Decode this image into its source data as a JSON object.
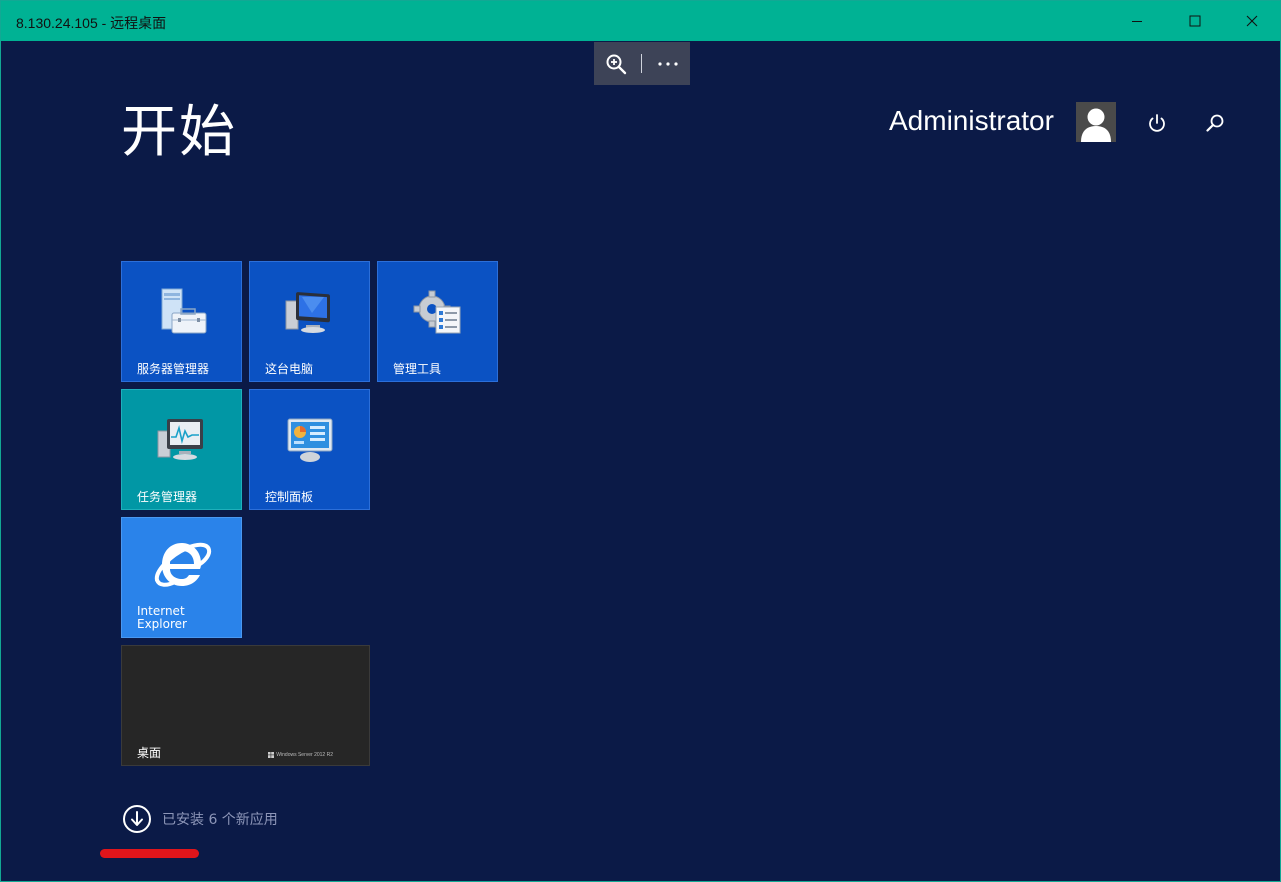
{
  "window": {
    "title": "8.130.24.105 - 远程桌面",
    "accent_color": "#00b294",
    "controls": [
      "minimize-icon",
      "maximize-icon",
      "close-icon"
    ]
  },
  "rdp_bar": {
    "icons": [
      "zoom-in-icon",
      "more-options-icon"
    ]
  },
  "start": {
    "title": "开始",
    "user": {
      "name": "Administrator",
      "avatar_icon": "user-avatar-icon"
    },
    "top_icons": [
      "power-icon",
      "search-icon"
    ],
    "background_color": "#0b1a47"
  },
  "tiles": [
    {
      "label": "服务器管理器",
      "icon": "server-manager-icon",
      "color": "#0b52c3"
    },
    {
      "label": "这台电脑",
      "icon": "computer-icon",
      "color": "#0b52c3"
    },
    {
      "label": "管理工具",
      "icon": "admin-tools-icon",
      "color": "#0b52c3"
    },
    {
      "label": "任务管理器",
      "icon": "task-manager-icon",
      "color": "#0197a5"
    },
    {
      "label": "控制面板",
      "icon": "control-panel-icon",
      "color": "#0b52c3"
    },
    {
      "label_line1": "Internet",
      "label_line2": "Explorer",
      "icon": "internet-explorer-icon",
      "color": "#2a83ea"
    },
    {
      "label": "桌面",
      "brand": "Windows Server 2012 R2",
      "icon": "windows-logo-icon",
      "color": "#262626"
    }
  ],
  "apps_notice": {
    "text": "已安装 6 个新应用",
    "icon": "arrow-down-circle-icon"
  }
}
